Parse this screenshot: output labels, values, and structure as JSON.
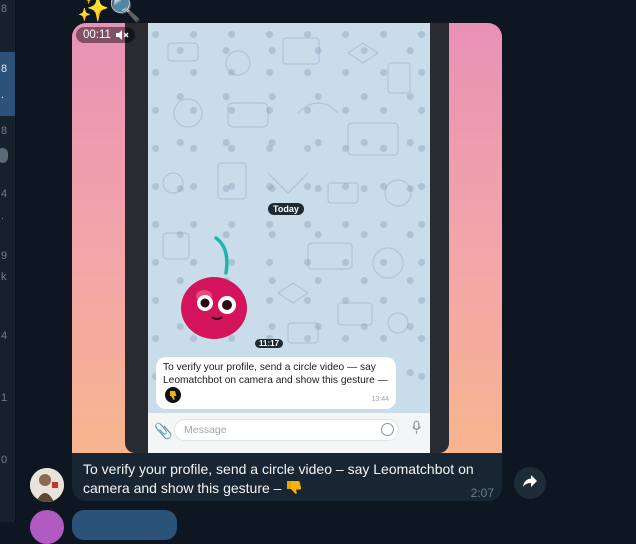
{
  "left_strip": {
    "items": [
      "8",
      "8",
      ".",
      "8",
      "4",
      ".",
      "9",
      "k",
      "4",
      "1",
      "0"
    ]
  },
  "message": {
    "emoji": "✨🔍",
    "duration": "00:11",
    "caption": "To verify your profile, send a circle video – say Leomatchbot on camera and show this gesture –",
    "caption_emoji": "👎",
    "time": "2:07",
    "icons": {
      "mute": "muted-speaker-icon",
      "share": "share-arrow-icon",
      "thumbs": "thumbs-down-icon"
    }
  },
  "video": {
    "today_label": "Today",
    "time_pill": "11:17",
    "inner_message": "To verify your profile, send a circle video — say Leomatchbot on camera and show this gesture —",
    "inner_time": "13:44",
    "input_placeholder": "Message",
    "colors": {
      "gradient_top": "#e991b5",
      "gradient_bottom": "#f6b58f",
      "chat_bg": "#c9dcea"
    }
  },
  "colors": {
    "app_bg": "#0e1621",
    "bubble_bg": "#182533",
    "active_item": "#2b5278"
  }
}
